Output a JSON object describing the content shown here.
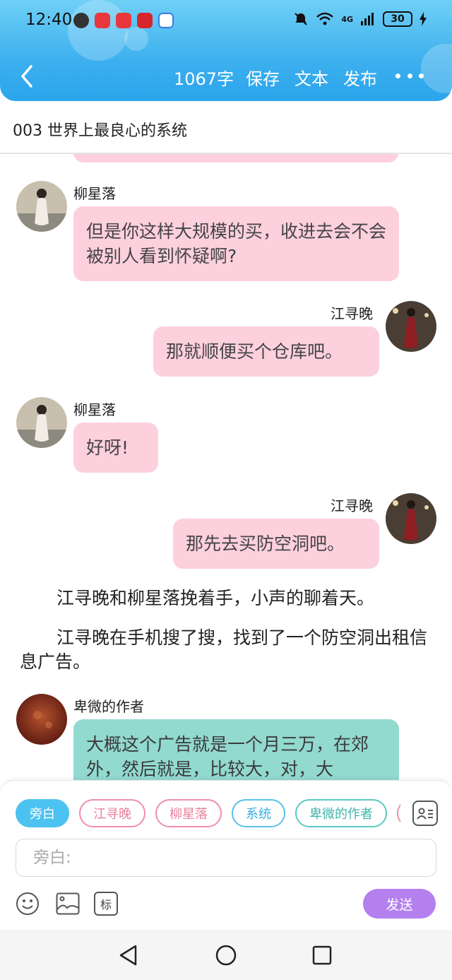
{
  "status_bar": {
    "time": "12:40",
    "network": "4G",
    "battery": "30"
  },
  "toolbar": {
    "word_count": "1067字",
    "save": "保存",
    "text": "文本",
    "publish": "发布"
  },
  "chapter": {
    "title": "003 世界上最良心的系统"
  },
  "messages": [
    {
      "speaker": "柳星落",
      "text": "但是你这样大规模的买，收进去会不会被别人看到怀疑啊?"
    },
    {
      "speaker": "江寻晚",
      "text": "那就顺便买个仓库吧。"
    },
    {
      "speaker": "柳星落",
      "text": "好呀!"
    },
    {
      "speaker": "江寻晚",
      "text": "那先去买防空洞吧。"
    }
  ],
  "narration": [
    "江寻晚和柳星落挽着手，小声的聊着天。",
    "江寻晚在手机搜了搜，找到了一个防空洞出租信息广告。"
  ],
  "author_message": {
    "speaker": "卑微的作者",
    "text": "大概这个广告就是一个月三万，在郊外，然后就是，比较大，对，大"
  },
  "composer": {
    "chips": [
      {
        "label": "旁白",
        "style": "active"
      },
      {
        "label": "江寻晚",
        "style": "pink"
      },
      {
        "label": "柳星落",
        "style": "pink"
      },
      {
        "label": "系统",
        "style": "blue"
      },
      {
        "label": "卑微的作者",
        "style": "teal"
      }
    ],
    "input_placeholder": "旁白:",
    "mark_label": "标",
    "send_label": "发送"
  },
  "colors": {
    "header": "#3db0ee",
    "bubble_pink": "#fdd0dd",
    "bubble_teal": "#92d9d0",
    "send": "#b480ee"
  }
}
